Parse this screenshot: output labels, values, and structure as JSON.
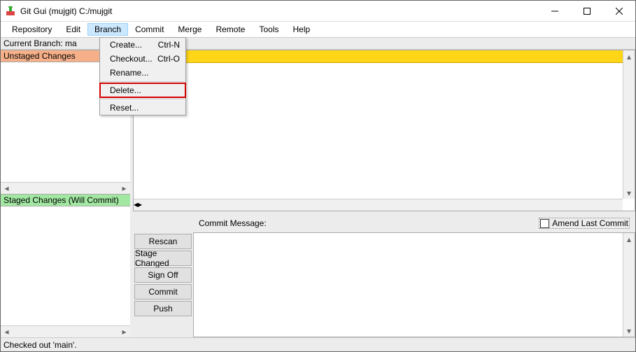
{
  "window": {
    "title": "Git Gui (mujgit) C:/mujgit"
  },
  "menubar": {
    "items": [
      "Repository",
      "Edit",
      "Branch",
      "Commit",
      "Merge",
      "Remote",
      "Tools",
      "Help"
    ],
    "open_index": 2
  },
  "branch_row": {
    "label": "Current Branch: ma"
  },
  "panes": {
    "unstaged_header": "Unstaged Changes",
    "staged_header": "Staged Changes (Will Commit)"
  },
  "commit": {
    "message_label": "Commit Message:",
    "amend_label": "Amend Last Commit",
    "buttons": [
      "Rescan",
      "Stage Changed",
      "Sign Off",
      "Commit",
      "Push"
    ]
  },
  "status": {
    "text": "Checked out 'main'."
  },
  "dropdown": {
    "items": [
      {
        "label": "Create...",
        "shortcut": "Ctrl-N"
      },
      {
        "label": "Checkout...",
        "shortcut": "Ctrl-O"
      },
      {
        "label": "Rename...",
        "shortcut": ""
      },
      {
        "label": "Delete...",
        "shortcut": "",
        "highlight": true
      },
      {
        "label": "Reset...",
        "shortcut": ""
      }
    ]
  }
}
